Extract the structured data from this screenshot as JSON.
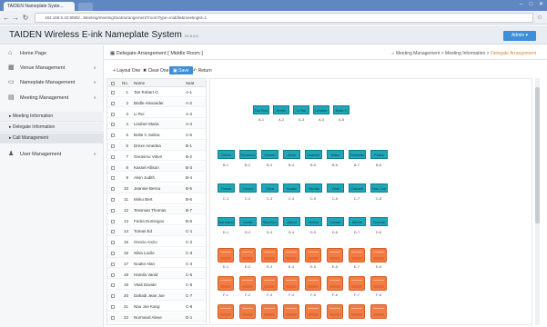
{
  "browser": {
    "tab_title": "TAIDEN Nameplate Syste...",
    "url": "192.168.5.42:8080/...Meeting/meetingSeat/arrangement?roomType=middle&meetingId=1",
    "back_icon": "back-arrow-icon",
    "forward_icon": "forward-arrow-icon",
    "refresh_icon": "refresh-icon"
  },
  "app": {
    "title": "TAIDEN Wireless E-ink Nameplate System",
    "version": "V1.0.0.0",
    "admin_label": "Admin ▾"
  },
  "sidebar": {
    "items": [
      {
        "label": "Home Page",
        "icon": "home-icon"
      },
      {
        "label": "Venue Management",
        "icon": "grid-icon"
      },
      {
        "label": "Nameplate Management",
        "icon": "nameplate-icon"
      },
      {
        "label": "Meeting Management",
        "icon": "calendar-icon"
      }
    ],
    "subitems": [
      {
        "label": "Meeting Information"
      },
      {
        "label": "Delegate Information"
      },
      {
        "label": "Call Management"
      }
    ],
    "user_item": {
      "label": "User Management",
      "icon": "user-icon"
    }
  },
  "breadcrumb": {
    "left": "Delegate Arrangement   [ Middle Room ]",
    "home": "Meeting Management",
    "mid": "Meeting Information",
    "current": "Delegate Arrangement"
  },
  "toolbar": {
    "layout": "+ Layout One",
    "clear": "✖ Clear One",
    "save": "Save",
    "return": "Return"
  },
  "table": {
    "headers": {
      "no": "No.",
      "name": "Name",
      "seat": "Seat"
    },
    "rows": [
      {
        "no": "1",
        "name": "Tan Robert O",
        "seat": "A-1"
      },
      {
        "no": "2",
        "name": "Bridle Alexander",
        "seat": "A-2"
      },
      {
        "no": "3",
        "name": "Li Rui",
        "seat": "A-3"
      },
      {
        "no": "4",
        "name": "Lindner Maria",
        "seat": "A-4"
      },
      {
        "no": "5",
        "name": "Bolte C Salina",
        "seat": "A-5"
      },
      {
        "no": "6",
        "name": "Drexe Amedea",
        "seat": "B-1"
      },
      {
        "no": "7",
        "name": "Gerasmo Vittori",
        "seat": "B-2"
      },
      {
        "no": "8",
        "name": "Kassel Allison",
        "seat": "B-3"
      },
      {
        "no": "9",
        "name": "Alvin Judith",
        "seat": "B-4"
      },
      {
        "no": "10",
        "name": "Jeannie Berna",
        "seat": "B-5"
      },
      {
        "no": "11",
        "name": "Mirko Bert",
        "seat": "B-6"
      },
      {
        "no": "12",
        "name": "Tessman Thomas",
        "seat": "B-7"
      },
      {
        "no": "13",
        "name": "Fedra Domingos",
        "seat": "B-8"
      },
      {
        "no": "14",
        "name": "Tomas Ed",
        "seat": "C-1"
      },
      {
        "no": "15",
        "name": "Onorio Anzio",
        "seat": "C-2"
      },
      {
        "no": "16",
        "name": "Silva Lucile",
        "seat": "C-3"
      },
      {
        "no": "17",
        "name": "Noake Alan",
        "seat": "C-4"
      },
      {
        "no": "18",
        "name": "Hamila Vanid",
        "seat": "C-5"
      },
      {
        "no": "19",
        "name": "Vitali Davide",
        "seat": "C-6"
      },
      {
        "no": "20",
        "name": "Dahadi Jean Joe",
        "seat": "C-7"
      },
      {
        "no": "21",
        "name": "Nau Joe Kang",
        "seat": "C-8"
      },
      {
        "no": "22",
        "name": "Normand Alexe",
        "seat": "D-1"
      }
    ]
  },
  "seatmap": {
    "colors": {
      "nameplate": "#1fa7b8",
      "chair": "#f27d44"
    },
    "rows": [
      {
        "labels": [
          "A-1",
          "A-2",
          "A-3",
          "A-4",
          "A-5"
        ],
        "names": [
          "Tan Rob",
          "Bridle",
          "Li Rui",
          "Lindner",
          "Bolte C"
        ]
      },
      {
        "labels": [
          "B-1",
          "B-2",
          "B-3",
          "B-4",
          "B-5",
          "B-6",
          "B-7",
          "B-8"
        ],
        "names": [
          "Drexe",
          "Gerasmo",
          "Kassel",
          "Alvin",
          "Jeannie",
          "Mirko",
          "Tessman",
          "Fedra"
        ]
      },
      {
        "labels": [
          "C-1",
          "C-2",
          "C-3",
          "C-4",
          "C-5",
          "C-6",
          "C-7",
          "C-8"
        ],
        "names": [
          "Tomas",
          "Onorio",
          "Silva",
          "Noake",
          "Hamila",
          "Vitali",
          "Dahadi",
          "Nau Joe"
        ]
      },
      {
        "labels": [
          "D-1",
          "D-2",
          "D-3",
          "D-4",
          "D-5",
          "D-6",
          "D-7",
          "D-8"
        ],
        "names": [
          "Normand",
          "Krolle",
          "Sanchez",
          "Jalton",
          "Norisa",
          "Lucian",
          "Mirtha",
          "Dubois"
        ]
      }
    ],
    "chair_rows": [
      {
        "labels": [
          "E-1",
          "E-2",
          "E-3",
          "E-4",
          "E-5",
          "E-6",
          "E-7",
          "E-8"
        ]
      },
      {
        "labels": [
          "F-1",
          "F-2",
          "F-3",
          "F-4",
          "F-5",
          "F-6",
          "F-7",
          "F-8"
        ]
      },
      {
        "labels": [
          "G-1",
          "G-2",
          "G-3",
          "G-4",
          "G-5",
          "G-6",
          "G-7",
          "G-8"
        ]
      }
    ]
  }
}
